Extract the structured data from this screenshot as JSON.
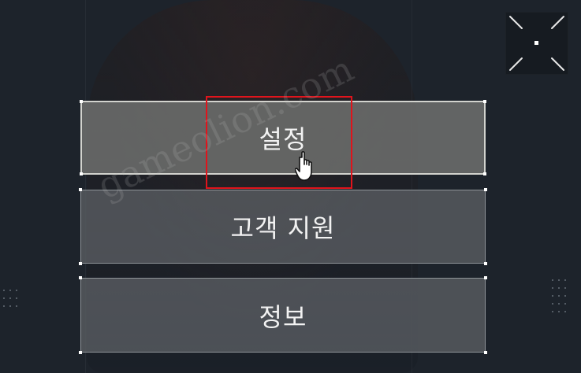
{
  "menu": {
    "items": [
      {
        "label": "설정",
        "state": "hovered"
      },
      {
        "label": "고객 지원",
        "state": "normal"
      },
      {
        "label": "정보",
        "state": "normal"
      }
    ]
  },
  "fullscreen": {
    "icon": "fullscreen-toggle-icon"
  },
  "watermark": {
    "text": "gameolion.com"
  },
  "highlight": {
    "color": "#e0141c"
  },
  "cursor": {
    "icon": "hand-pointer-icon"
  }
}
